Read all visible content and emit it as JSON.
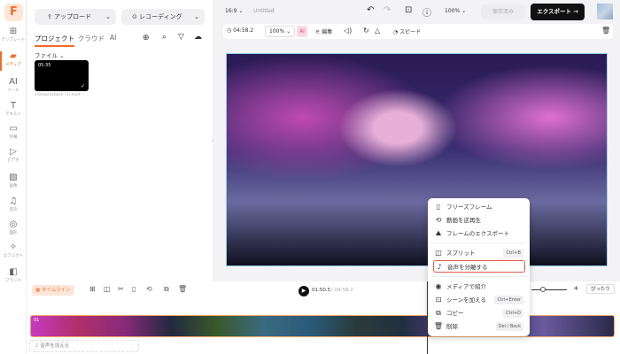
{
  "sidebar": {
    "logo": "F",
    "items": [
      {
        "label": "テンプレート",
        "icon": "template-icon",
        "glyph": "⊞"
      },
      {
        "label": "メディア",
        "icon": "folder-icon",
        "glyph": "▰"
      },
      {
        "label": "ツール",
        "icon": "ai-tool-icon",
        "glyph": "AI"
      },
      {
        "label": "テキスト",
        "icon": "text-icon",
        "glyph": "T"
      },
      {
        "label": "字幕",
        "icon": "subtitle-icon",
        "glyph": "▭"
      },
      {
        "label": "ビデオ",
        "icon": "video-icon",
        "glyph": "▷"
      },
      {
        "label": "画像",
        "icon": "image-icon",
        "glyph": "▨"
      },
      {
        "label": "音声",
        "icon": "music-icon",
        "glyph": "♫"
      },
      {
        "label": "図形",
        "icon": "shape-icon",
        "glyph": "◎"
      },
      {
        "label": "エフェクト",
        "icon": "effect-icon",
        "glyph": "✧"
      },
      {
        "label": "ブランド",
        "icon": "brand-icon",
        "glyph": "◧"
      }
    ]
  },
  "panel": {
    "upload": "アップロード",
    "recording": "レコーディング",
    "tabs": [
      "プロジェクト",
      "クラウド",
      "AI"
    ],
    "files_label": "ファイル",
    "file": {
      "duration": "05:35",
      "name": "videoplayback (1).mp4"
    }
  },
  "topbar": {
    "ratio": "16:9",
    "title": "Untitled",
    "zoom": "100%",
    "saved": "保存済み",
    "export": "エクスポート →"
  },
  "toolbar": {
    "duration": "04:58.2",
    "scale": "100%",
    "ai": "AI",
    "edit": "編集",
    "speed": "スピード"
  },
  "timeline": {
    "label": "タイムライン",
    "current": "01:50.5",
    "total": "/ 04:58.2",
    "fit": "ぴったり",
    "clip_label": "01",
    "add_audio": "音声を加える"
  },
  "context_menu": [
    {
      "label": "フリーズフレーム",
      "icon": "freeze-frame-icon",
      "glyph": "▯"
    },
    {
      "label": "動画を逆再生",
      "icon": "reverse-icon",
      "glyph": "⟲"
    },
    {
      "label": "フレームのエクスポート",
      "icon": "export-frame-icon",
      "glyph": "⛰"
    },
    {
      "label": "スプリット",
      "icon": "split-icon",
      "glyph": "◫",
      "shortcut": "Ctrl+B"
    },
    {
      "label": "音声を分離する",
      "icon": "detach-audio-icon",
      "glyph": "♪",
      "highlighted": true
    },
    {
      "label": "メディアで紹介",
      "icon": "location-icon",
      "glyph": "◉"
    },
    {
      "label": "シーンを加える",
      "icon": "add-scene-icon",
      "glyph": "⊡",
      "shortcut": "Ctrl+Enter"
    },
    {
      "label": "コピー",
      "icon": "copy-icon",
      "glyph": "⧉",
      "shortcut": "Ctrl+D"
    },
    {
      "label": "削除",
      "icon": "trash-icon",
      "glyph": "🗑",
      "shortcut": "Del / Back"
    }
  ],
  "colors": {
    "accent": "#f26b2a",
    "highlight": "#e25b45",
    "export_bg": "#111111"
  }
}
